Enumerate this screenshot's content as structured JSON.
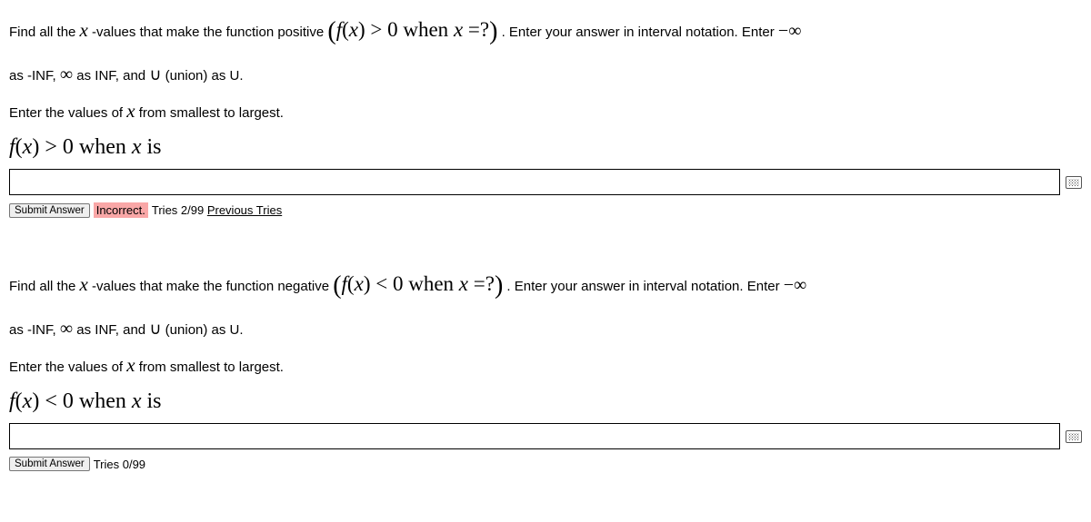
{
  "q1": {
    "text1a": "Find all the ",
    "text1b": " -values that make the function positive ",
    "math1": "(f(x) > 0 when x =?)",
    "text2": " . Enter your answer in interval notation. Enter ",
    "neginf": "−∞",
    "text3a": "as -INF, ",
    "infinity": "∞",
    "text3b": " as INF, and ",
    "union": "∪",
    "text3c": " (union) as U.",
    "text4a": "Enter the values of ",
    "text4b": " from smallest to largest.",
    "prompt": "f(x) > 0 when x is",
    "submit": "Submit Answer",
    "status": "Incorrect.",
    "tries": "Tries 2/99 ",
    "prev": "Previous Tries"
  },
  "q2": {
    "text1a": "Find all the ",
    "text1b": " -values that make the function negative ",
    "math1": "(f(x) < 0 when x =?)",
    "text2": " . Enter your answer in interval notation. Enter ",
    "neginf": "−∞",
    "text3a": "as -INF, ",
    "infinity": "∞",
    "text3b": " as INF, and ",
    "union": "∪",
    "text3c": " (union) as U.",
    "text4a": "Enter the values of ",
    "text4b": " from smallest to largest.",
    "prompt": "f(x) < 0 when x is",
    "submit": "Submit Answer",
    "tries": "Tries 0/99"
  }
}
